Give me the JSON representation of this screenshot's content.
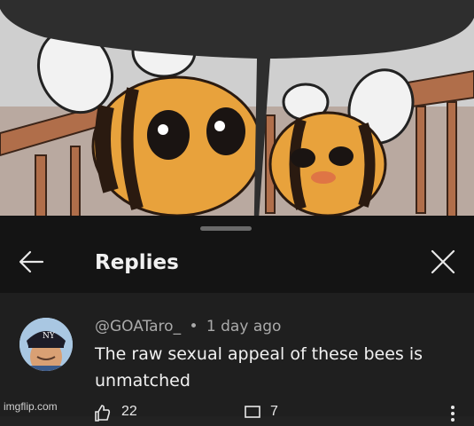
{
  "panel": {
    "title": "Replies",
    "back_icon": "arrow-left-icon",
    "close_icon": "close-icon"
  },
  "comment": {
    "author": "@GOATaro_",
    "separator": "•",
    "time": "1 day ago",
    "text_line1": "The raw sexual appeal of these bees is",
    "text_line2": "unmatched"
  },
  "actions": {
    "like_icon": "thumbs-up-icon",
    "like_count": "22",
    "reply_icon": "comment-icon",
    "reply_count": "7",
    "more_icon": "more-vertical-icon"
  },
  "watermark": "imgflip.com",
  "colors": {
    "panel_bg": "#1f1f1f",
    "header_bg": "#141414",
    "bubble": "#2e2e2e",
    "bee_body": "#e8a23c",
    "bee_stripe": "#2a1a10"
  }
}
